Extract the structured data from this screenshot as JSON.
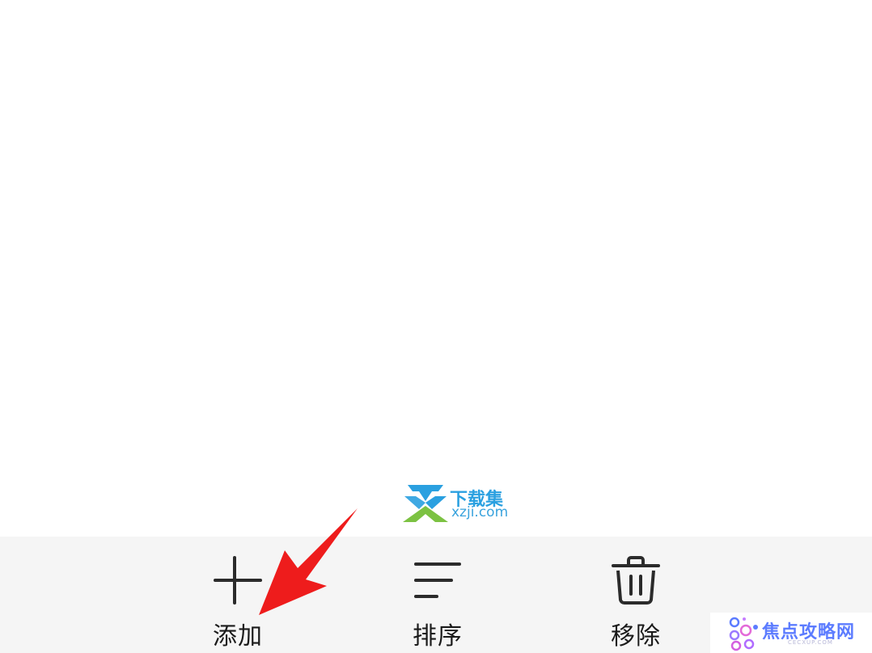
{
  "bottom_bar": {
    "actions": [
      {
        "id": "add",
        "icon": "plus-icon",
        "label": "添加"
      },
      {
        "id": "sort",
        "icon": "sort-lines-icon",
        "label": "排序"
      },
      {
        "id": "remove",
        "icon": "trash-icon",
        "label": "移除"
      }
    ]
  },
  "watermarks": {
    "xzji": {
      "brand": "下载集",
      "domain": "xzji.com"
    },
    "cecxup": {
      "brand": "焦点攻略网",
      "sub": "CECXUP.COM"
    }
  },
  "annotation": {
    "icon": "red-pointer-arrow"
  },
  "colors": {
    "bar_background": "#f5f5f5",
    "icon_stroke": "#2b2b2b",
    "arrow_red": "#ee1c1c",
    "xzji_blue": "#2aa0e0",
    "xzji_green": "#7cc242",
    "cecxup_purple": "#5c7cff"
  }
}
